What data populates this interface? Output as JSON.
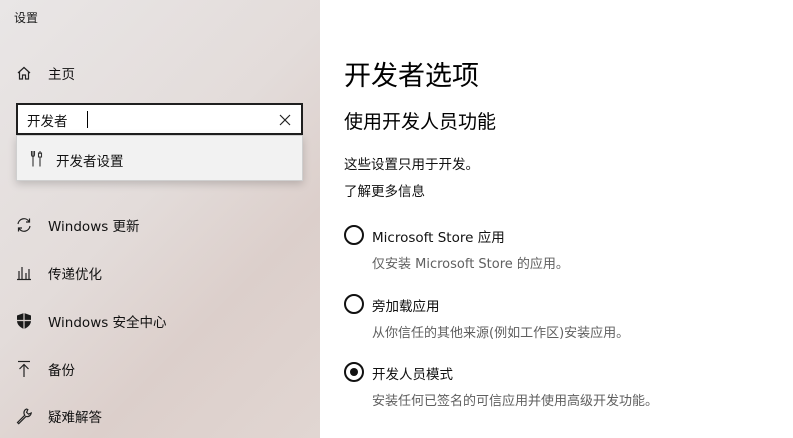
{
  "window": {
    "title": "设置"
  },
  "sidebar": {
    "home": {
      "label": "主页",
      "icon": "home-icon"
    },
    "search": {
      "value": "开发者",
      "placeholder": ""
    },
    "suggestion": {
      "label": "开发者设置",
      "icon": "developer-settings-icon"
    },
    "items": [
      {
        "label": "Windows 更新",
        "icon": "sync-icon"
      },
      {
        "label": "传递优化",
        "icon": "delivery-optimization-icon"
      },
      {
        "label": "Windows 安全中心",
        "icon": "shield-icon"
      },
      {
        "label": "备份",
        "icon": "upload-arrow-icon"
      },
      {
        "label": "疑难解答",
        "icon": "wrench-icon"
      }
    ]
  },
  "main": {
    "title": "开发者选项",
    "section_title": "使用开发人员功能",
    "description": "这些设置只用于开发。",
    "learn_more": "了解更多信息",
    "options": [
      {
        "label": "Microsoft Store 应用",
        "sub": "仅安装 Microsoft Store 的应用。",
        "checked": false
      },
      {
        "label": "旁加载应用",
        "sub": "从你信任的其他来源(例如工作区)安装应用。",
        "checked": false
      },
      {
        "label": "开发人员模式",
        "sub": "安装任何已签名的可信应用并使用高级开发功能。",
        "checked": true
      }
    ]
  }
}
